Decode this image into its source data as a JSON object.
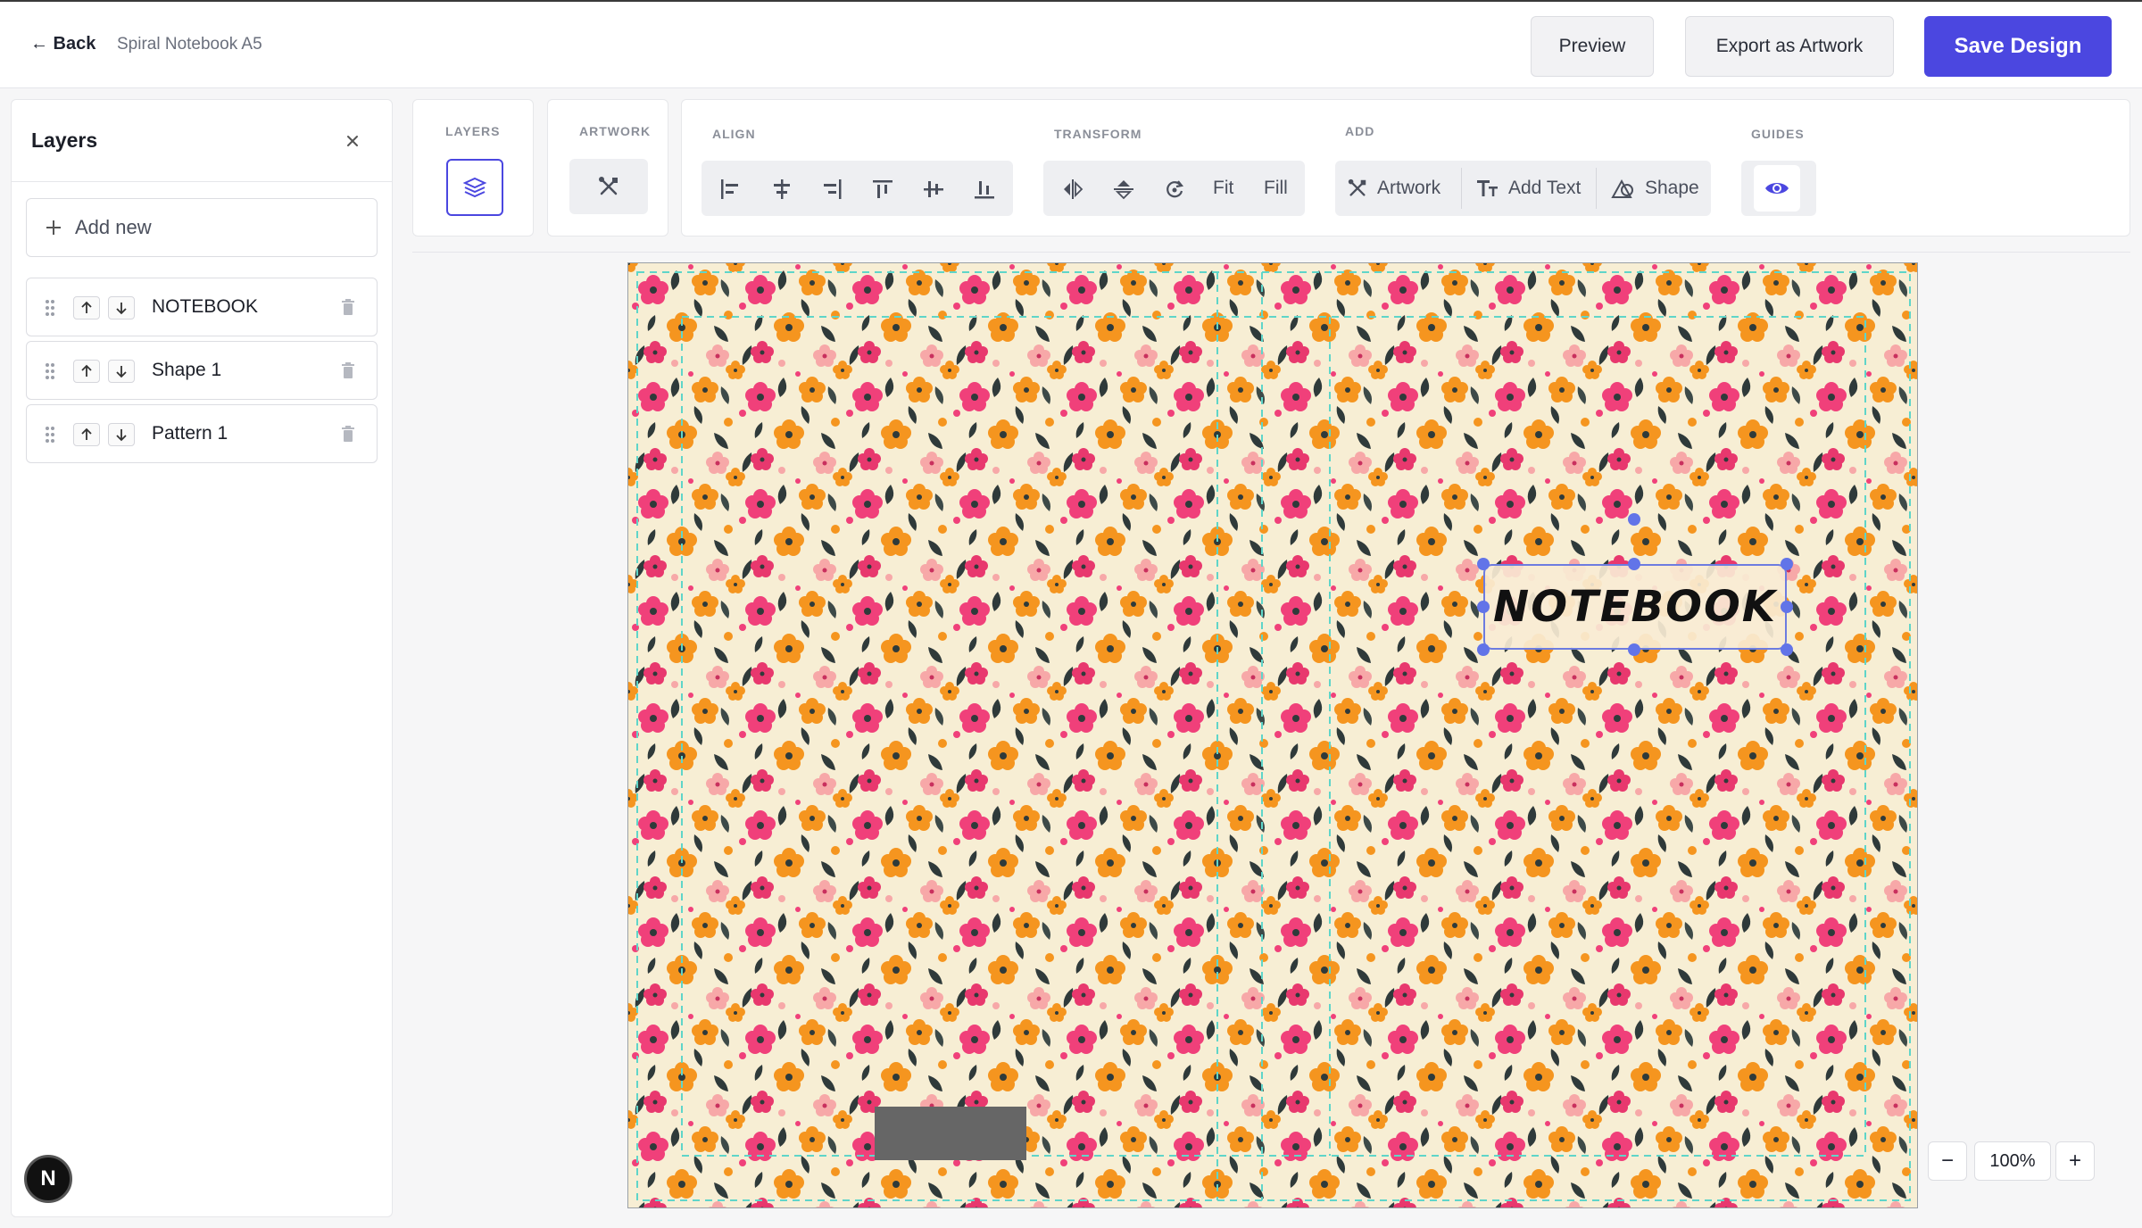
{
  "topbar": {
    "back_label": "← Back",
    "doc_title": "Spiral Notebook A5",
    "preview_label": "Preview",
    "export_label": "Export as Artwork",
    "save_label": "Save Design"
  },
  "layers_panel": {
    "title": "Layers",
    "add_new_label": "Add new",
    "layers": [
      {
        "name": "NOTEBOOK"
      },
      {
        "name": "Shape 1"
      },
      {
        "name": "Pattern 1"
      }
    ]
  },
  "toolbar": {
    "layers_label": "LAYERS",
    "artwork_label": "ARTWORK",
    "align_label": "ALIGN",
    "transform_label": "TRANSFORM",
    "fit_label": "Fit",
    "fill_label": "Fill",
    "add_label": "ADD",
    "add_artwork_label": "Artwork",
    "add_text_label": "Add Text",
    "add_shape_label": "Shape",
    "guides_label": "GUIDES"
  },
  "canvas": {
    "text_element": "NOTEBOOK",
    "pattern_colors": [
      "#f0407a",
      "#f5951f",
      "#f7a8a8",
      "#2f3a3a",
      "#f7eed4"
    ]
  },
  "zoom": {
    "minus_label": "−",
    "value": "100%",
    "plus_label": "+"
  },
  "badge": {
    "letter": "N"
  },
  "colors": {
    "accent": "#4b47e0",
    "selection": "#6274e8",
    "guides": "#5fd5c9"
  }
}
